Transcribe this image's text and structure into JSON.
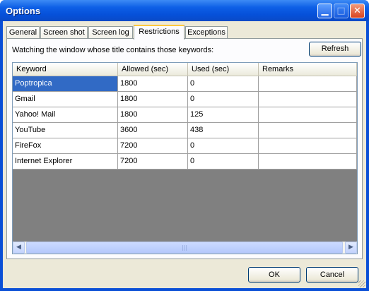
{
  "window": {
    "title": "Options"
  },
  "title_buttons": {
    "minimize_glyph": "▁",
    "maximize_glyph": "□",
    "close_glyph": "✕"
  },
  "tabs": [
    {
      "label": "General",
      "active": false
    },
    {
      "label": "Screen shot",
      "active": false
    },
    {
      "label": "Screen log",
      "active": false
    },
    {
      "label": "Restrictions",
      "active": true
    },
    {
      "label": "Exceptions",
      "active": false
    }
  ],
  "restrictions": {
    "description": "Watching the window whose title contains those keywords:",
    "refresh_label": "Refresh",
    "columns": [
      "Keyword",
      "Allowed (sec)",
      "Used (sec)",
      "Remarks"
    ],
    "rows": [
      [
        "Poptropica",
        "1800",
        "0",
        ""
      ],
      [
        "Gmail",
        "1800",
        "0",
        ""
      ],
      [
        "Yahoo! Mail",
        "1800",
        "125",
        ""
      ],
      [
        "YouTube",
        "3600",
        "438",
        ""
      ],
      [
        "FireFox",
        "7200",
        "0",
        ""
      ],
      [
        "Internet Explorer",
        "7200",
        "0",
        ""
      ]
    ],
    "selected_row": 0
  },
  "footer": {
    "ok_label": "OK",
    "cancel_label": "Cancel"
  },
  "colors": {
    "title_bar": "#0a4fd6",
    "selection": "#316ac5",
    "dialog_bg": "#ece9d8",
    "active_tab_accent": "#ffc83c"
  }
}
